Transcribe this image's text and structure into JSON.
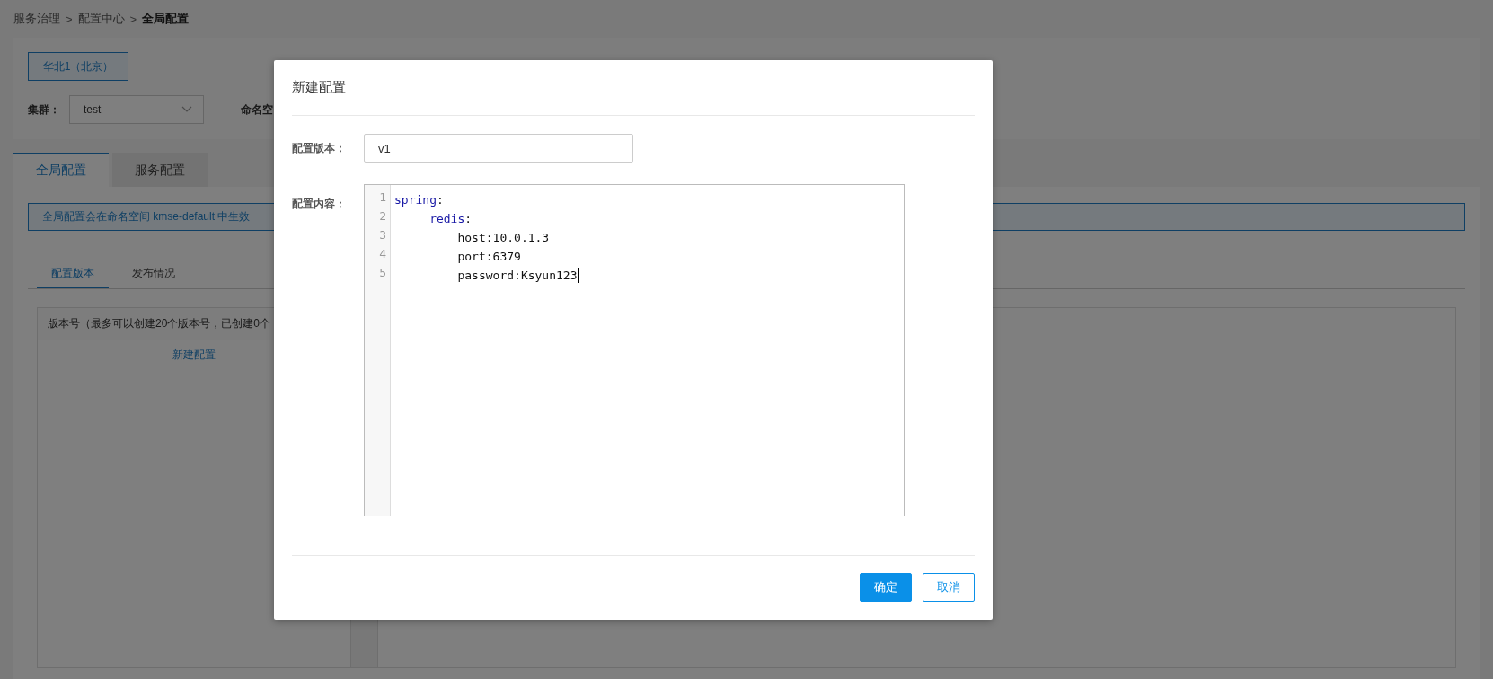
{
  "breadcrumb": {
    "separator": ">",
    "items": [
      {
        "label": "服务治理",
        "current": false
      },
      {
        "label": "配置中心",
        "current": false
      },
      {
        "label": "全局配置",
        "current": true
      }
    ]
  },
  "region_button": "华北1（北京）",
  "cluster": {
    "label": "集群：",
    "value": "test"
  },
  "namespace_label": "命名空",
  "tabs": [
    {
      "label": "全局配置",
      "selected": true
    },
    {
      "label": "服务配置",
      "selected": false
    }
  ],
  "notice": "全局配置会在命名空间 kmse-default 中生效",
  "subtabs": [
    {
      "label": "配置版本",
      "selected": true
    },
    {
      "label": "发布情况",
      "selected": false
    }
  ],
  "version_panel": {
    "header": "版本号（最多可以创建20个版本号，已创建0个",
    "new_link": "新建配置"
  },
  "dialog": {
    "title": "新建配置",
    "version_field": {
      "label": "配置版本：",
      "value": "v1"
    },
    "editor": {
      "label": "配置内容：",
      "lines": [
        {
          "number": "1",
          "cursor": false,
          "tokens": [
            {
              "text": "spring",
              "kind": "key"
            },
            {
              "text": ":",
              "kind": "punct"
            }
          ]
        },
        {
          "number": "2",
          "cursor": false,
          "tokens": [
            {
              "text": "     redis",
              "kind": "key"
            },
            {
              "text": ":",
              "kind": "punct"
            }
          ]
        },
        {
          "number": "3",
          "cursor": false,
          "tokens": [
            {
              "text": "         host:10.0.1.3",
              "kind": "plain"
            }
          ]
        },
        {
          "number": "4",
          "cursor": false,
          "tokens": [
            {
              "text": "         port:6379",
              "kind": "plain"
            }
          ]
        },
        {
          "number": "5",
          "cursor": true,
          "tokens": [
            {
              "text": "         password:Ksyun123",
              "kind": "plain"
            }
          ]
        }
      ]
    },
    "buttons": [
      {
        "label": "确定",
        "kind": "primary"
      },
      {
        "label": "取消",
        "kind": "secondary"
      }
    ]
  }
}
